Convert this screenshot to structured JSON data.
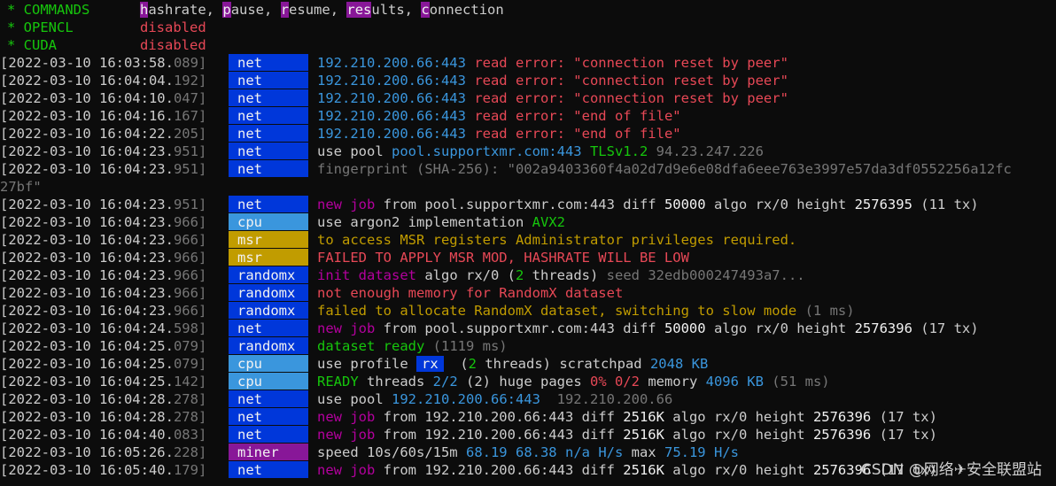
{
  "header": [
    {
      "label": "* COMMANDS",
      "value": "",
      "cmds": [
        [
          "h",
          "ashrate, "
        ],
        [
          "p",
          "ause, "
        ],
        [
          "r",
          "esume, "
        ],
        [
          "res",
          "ults, "
        ],
        [
          "c",
          "onnection"
        ]
      ]
    },
    {
      "label": "* OPENCL",
      "value": "disabled"
    },
    {
      "label": "* CUDA",
      "value": "disabled"
    }
  ],
  "rows": [
    {
      "ts": "[2022-03-10 16:03:58.",
      "ms": "089]",
      "tag": "net",
      "segs": [
        [
          "c",
          "192.210.200.66:443 "
        ],
        [
          "r",
          "read error: \"connection reset by peer\""
        ]
      ]
    },
    {
      "ts": "[2022-03-10 16:04:04.",
      "ms": "192]",
      "tag": "net",
      "segs": [
        [
          "c",
          "192.210.200.66:443 "
        ],
        [
          "r",
          "read error: \"connection reset by peer\""
        ]
      ]
    },
    {
      "ts": "[2022-03-10 16:04:10.",
      "ms": "047]",
      "tag": "net",
      "segs": [
        [
          "c",
          "192.210.200.66:443 "
        ],
        [
          "r",
          "read error: \"connection reset by peer\""
        ]
      ]
    },
    {
      "ts": "[2022-03-10 16:04:16.",
      "ms": "167]",
      "tag": "net",
      "segs": [
        [
          "c",
          "192.210.200.66:443 "
        ],
        [
          "r",
          "read error: \"end of file\""
        ]
      ]
    },
    {
      "ts": "[2022-03-10 16:04:22.",
      "ms": "205]",
      "tag": "net",
      "segs": [
        [
          "c",
          "192.210.200.66:443 "
        ],
        [
          "r",
          "read error: \"end of file\""
        ]
      ]
    },
    {
      "ts": "[2022-03-10 16:04:23.",
      "ms": "951]",
      "tag": "net",
      "segs": [
        [
          "w",
          "use pool "
        ],
        [
          "c",
          "pool.supportxmr.com:443 "
        ],
        [
          "g",
          "TLSv1.2 "
        ],
        [
          "gray",
          "94.23.247.226"
        ]
      ]
    },
    {
      "ts": "[2022-03-10 16:04:23.",
      "ms": "951]",
      "tag": "net",
      "segs": [
        [
          "gray",
          "fingerprint (SHA-256): \"002a9403360f4a02d7d9e6e08dfa6eee763e3997e57da3df0552256a12fc"
        ]
      ]
    },
    {
      "ts": "27bf\"",
      "ms": "",
      "tag": "",
      "segs": []
    },
    {
      "ts": "[2022-03-10 16:04:23.",
      "ms": "951]",
      "tag": "net",
      "segs": [
        [
          "m",
          "new job "
        ],
        [
          "w",
          "from pool.supportxmr.com:443 diff "
        ],
        [
          "bw",
          "50000"
        ],
        [
          "w",
          " algo rx/0 height "
        ],
        [
          "bw",
          "2576395"
        ],
        [
          "w",
          " (11 tx)"
        ]
      ]
    },
    {
      "ts": "[2022-03-10 16:04:23.",
      "ms": "966]",
      "tag": "cpu",
      "segs": [
        [
          "w",
          "use argon2 implementation "
        ],
        [
          "g",
          "AVX2"
        ]
      ]
    },
    {
      "ts": "[2022-03-10 16:04:23.",
      "ms": "966]",
      "tag": "msr",
      "segs": [
        [
          "y",
          "to access MSR registers Administrator privileges required."
        ]
      ]
    },
    {
      "ts": "[2022-03-10 16:04:23.",
      "ms": "966]",
      "tag": "msr",
      "segs": [
        [
          "r",
          "FAILED TO APPLY MSR MOD, HASHRATE WILL BE LOW"
        ]
      ]
    },
    {
      "ts": "[2022-03-10 16:04:23.",
      "ms": "966]",
      "tag": "randomx",
      "segs": [
        [
          "m",
          "init dataset "
        ],
        [
          "w",
          "algo rx/0 ("
        ],
        [
          "g",
          "2"
        ],
        [
          "w",
          " threads) "
        ],
        [
          "gray",
          "seed 32edb000247493a7..."
        ]
      ]
    },
    {
      "ts": "[2022-03-10 16:04:23.",
      "ms": "966]",
      "tag": "randomx",
      "segs": [
        [
          "r",
          "not enough memory for RandomX dataset"
        ]
      ]
    },
    {
      "ts": "[2022-03-10 16:04:23.",
      "ms": "966]",
      "tag": "randomx",
      "segs": [
        [
          "y",
          "failed to allocate RandomX dataset, switching to slow mode "
        ],
        [
          "gray",
          "(1 ms)"
        ]
      ]
    },
    {
      "ts": "[2022-03-10 16:04:24.",
      "ms": "598]",
      "tag": "net",
      "segs": [
        [
          "m",
          "new job "
        ],
        [
          "w",
          "from pool.supportxmr.com:443 diff "
        ],
        [
          "bw",
          "50000"
        ],
        [
          "w",
          " algo rx/0 height "
        ],
        [
          "bw",
          "2576396"
        ],
        [
          "w",
          " (17 tx)"
        ]
      ]
    },
    {
      "ts": "[2022-03-10 16:04:25.",
      "ms": "079]",
      "tag": "randomx",
      "segs": [
        [
          "g",
          "dataset ready "
        ],
        [
          "gray",
          "(1119 ms)"
        ]
      ]
    },
    {
      "ts": "[2022-03-10 16:04:25.",
      "ms": "079]",
      "tag": "cpu",
      "segs": [
        [
          "w",
          "use profile "
        ],
        [
          "rx",
          "rx"
        ],
        [
          "w",
          "  ("
        ],
        [
          "g",
          "2"
        ],
        [
          "w",
          " threads) scratchpad "
        ],
        [
          "c",
          "2048 KB"
        ]
      ]
    },
    {
      "ts": "[2022-03-10 16:04:25.",
      "ms": "142]",
      "tag": "cpu",
      "segs": [
        [
          "g",
          "READY"
        ],
        [
          "w",
          " threads "
        ],
        [
          "c",
          "2/2"
        ],
        [
          "w",
          " (2) huge pages "
        ],
        [
          "r",
          "0% 0/2"
        ],
        [
          "w",
          " memory "
        ],
        [
          "c",
          "4096 KB"
        ],
        [
          "gray",
          " (51 ms)"
        ]
      ]
    },
    {
      "ts": "[2022-03-10 16:04:28.",
      "ms": "278]",
      "tag": "net",
      "segs": [
        [
          "w",
          "use pool "
        ],
        [
          "c",
          "192.210.200.66:443  "
        ],
        [
          "gray",
          "192.210.200.66"
        ]
      ]
    },
    {
      "ts": "[2022-03-10 16:04:28.",
      "ms": "278]",
      "tag": "net",
      "segs": [
        [
          "m",
          "new job "
        ],
        [
          "w",
          "from 192.210.200.66:443 diff "
        ],
        [
          "bw",
          "2516K"
        ],
        [
          "w",
          " algo rx/0 height "
        ],
        [
          "bw",
          "2576396"
        ],
        [
          "w",
          " (17 tx)"
        ]
      ]
    },
    {
      "ts": "[2022-03-10 16:04:40.",
      "ms": "083]",
      "tag": "net",
      "segs": [
        [
          "m",
          "new job "
        ],
        [
          "w",
          "from 192.210.200.66:443 diff "
        ],
        [
          "bw",
          "2516K"
        ],
        [
          "w",
          " algo rx/0 height "
        ],
        [
          "bw",
          "2576396"
        ],
        [
          "w",
          " (17 tx)"
        ]
      ]
    },
    {
      "ts": "[2022-03-10 16:05:26.",
      "ms": "228]",
      "tag": "miner",
      "segs": [
        [
          "w",
          "speed 10s/60s/15m "
        ],
        [
          "c",
          "68.19 "
        ],
        [
          "c",
          "68.38 "
        ],
        [
          "c",
          "n/a "
        ],
        [
          "c",
          "H/s"
        ],
        [
          "w",
          " max "
        ],
        [
          "c",
          "75.19 H/s"
        ]
      ]
    },
    {
      "ts": "[2022-03-10 16:05:40.",
      "ms": "179]",
      "tag": "net",
      "segs": [
        [
          "m",
          "new job "
        ],
        [
          "w",
          "from 192.210.200.66:443 diff "
        ],
        [
          "bw",
          "2516K"
        ],
        [
          "w",
          " algo rx/0 height "
        ],
        [
          "bw",
          "2576396"
        ],
        [
          "w",
          " (17 tx)"
        ]
      ]
    }
  ],
  "watermark": "CSDN @网络✈安全联盟站"
}
